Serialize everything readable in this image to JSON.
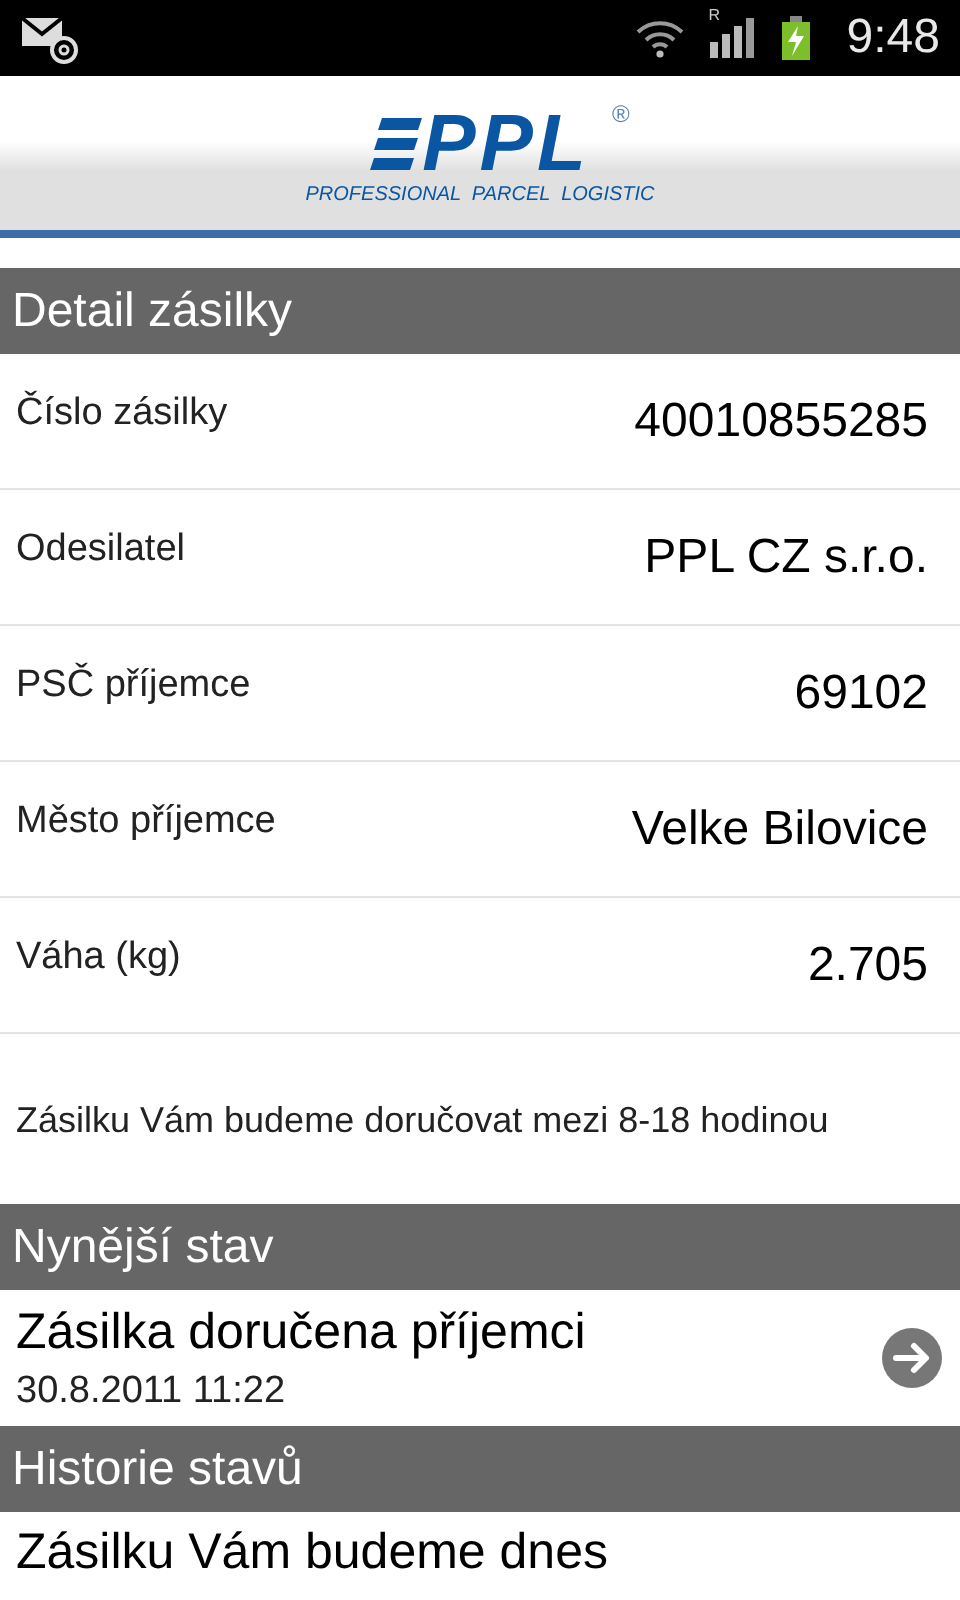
{
  "status_bar": {
    "roaming": "R",
    "time": "9:48"
  },
  "header": {
    "logo_text": "PPL",
    "registered": "®",
    "tagline": "PROFESSIONAL  PARCEL  LOGISTIC"
  },
  "detail": {
    "title": "Detail zásilky",
    "rows": [
      {
        "label": "Číslo zásilky",
        "value": "40010855285"
      },
      {
        "label": "Odesilatel",
        "value": "PPL CZ s.r.o."
      },
      {
        "label": "PSČ příjemce",
        "value": "69102"
      },
      {
        "label": "Město příjemce",
        "value": "Velke Bilovice"
      },
      {
        "label": "Váha (kg)",
        "value": "2.705"
      }
    ],
    "note": "Zásilku Vám budeme doručovat mezi 8-18 hodinou"
  },
  "current_state": {
    "title": "Nynější stav",
    "status": "Zásilka doručena příjemci",
    "date": "30.8.2011 11:22"
  },
  "history": {
    "title": "Historie stavů",
    "items": [
      {
        "status": "Zásilku Vám budeme dnes"
      }
    ]
  }
}
